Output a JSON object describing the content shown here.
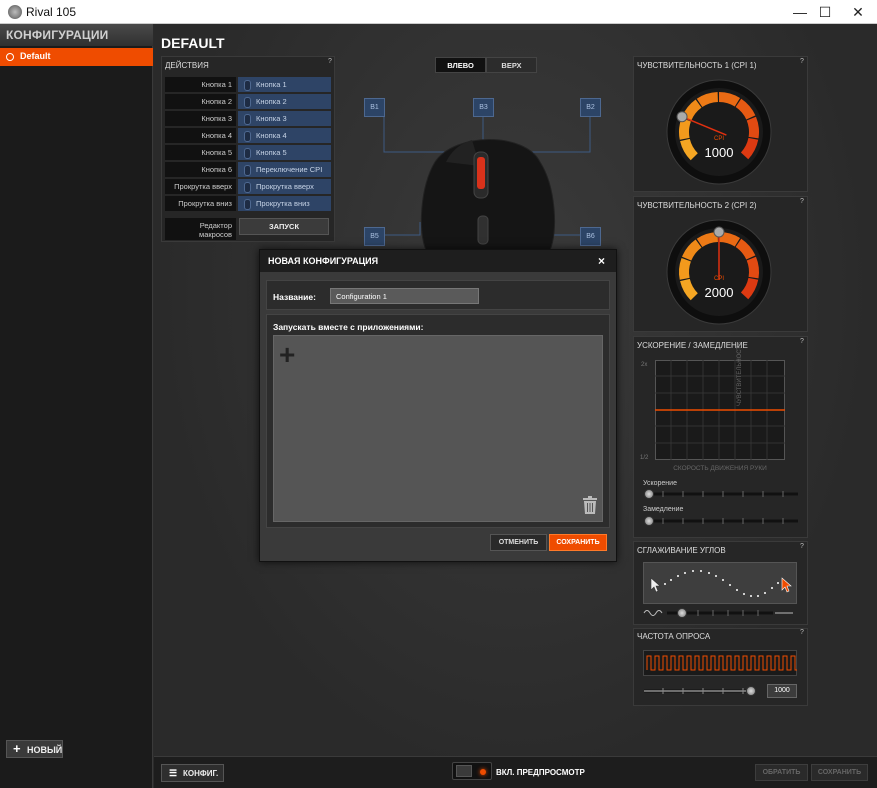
{
  "window": {
    "title": "Rival 105",
    "minimize_glyph": "—",
    "maximize_glyph": "☐",
    "close_glyph": "✕"
  },
  "sidebar": {
    "header": "КОНФИГУРАЦИИ",
    "items": [
      {
        "label": "Default",
        "selected": true
      }
    ],
    "new_button": "НОВЫЙ"
  },
  "main": {
    "title": "DEFAULT"
  },
  "actions": {
    "header": "ДЕЙСТВИЯ",
    "help": "?",
    "rows": [
      {
        "key": "Кнопка 1",
        "value": "Кнопка 1"
      },
      {
        "key": "Кнопка 2",
        "value": "Кнопка 2"
      },
      {
        "key": "Кнопка 3",
        "value": "Кнопка 3"
      },
      {
        "key": "Кнопка 4",
        "value": "Кнопка 4"
      },
      {
        "key": "Кнопка 5",
        "value": "Кнопка 5"
      },
      {
        "key": "Кнопка 6",
        "value": "Переключение CPI"
      },
      {
        "key": "Прокрутка вверх",
        "value": "Прокрутка вверх"
      },
      {
        "key": "Прокрутка вниз",
        "value": "Прокрутка вниз"
      }
    ],
    "macro_label": "Редактор макросов",
    "launch_button": "ЗАПУСК"
  },
  "view": {
    "left": "ВЛЕВО",
    "top": "ВЕРХ",
    "selected": "left"
  },
  "mouse_buttons": {
    "b1": "B1",
    "b2": "B2",
    "b3": "B3",
    "b5": "B5",
    "b6": "B6"
  },
  "sensitivity1": {
    "header": "ЧУВСТВИТЕЛЬНОСТЬ 1 (CPI 1)",
    "help": "?",
    "unit": "CPI",
    "value": "1000",
    "fraction": 0.25
  },
  "sensitivity2": {
    "header": "ЧУВСТВИТЕЛЬНОСТЬ 2 (CPI 2)",
    "help": "?",
    "unit": "CPI",
    "value": "2000",
    "fraction": 0.5
  },
  "acceleration": {
    "header": "УСКОРЕНИЕ / ЗАМЕДЛЕНИЕ",
    "help": "?",
    "y_top": "2x",
    "y_bottom": "1/2",
    "y_axis": "ЧУВСТВИТЕЛЬНОСТЬ",
    "x_axis": "СКОРОСТЬ ДВИЖЕНИЯ РУКИ",
    "accel_label": "Ускорение",
    "decel_label": "Замедление",
    "accel_value": 0,
    "decel_value": 0
  },
  "angle_snapping": {
    "header": "СГЛАЖИВАНИЕ УГЛОВ",
    "help": "?",
    "value": 0.1
  },
  "polling": {
    "header": "ЧАСТОТА ОПРОСА",
    "help": "?",
    "value": "1000",
    "fraction": 1.0
  },
  "modal": {
    "title": "НОВАЯ КОНФИГУРАЦИЯ",
    "close": "×",
    "name_label": "Название:",
    "name_value": "Configuration 1",
    "apps_label": "Запускать вместе с приложениями:",
    "cancel": "ОТМЕНИТЬ",
    "save": "СОХРАНИТЬ"
  },
  "bottom": {
    "config_button": "КОНФИГ.",
    "preview_label": "ВКЛ. ПРЕДПРОСМОТР",
    "revert": "ОБРАТИТЬ",
    "save_all": "СОХРАНИТЬ"
  },
  "colors": {
    "accent": "#ef4c00",
    "button_blue": "#2e4466"
  }
}
